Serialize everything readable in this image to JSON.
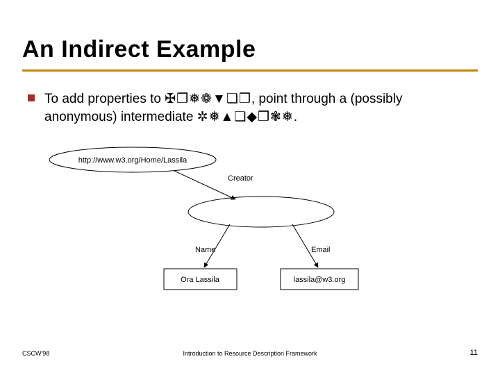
{
  "title": "An Indirect Example",
  "bullet": {
    "pre": "To add properties to ",
    "sym1": "✠❒❅❁▼❏❒",
    "mid": ", point through a (possibly anonymous) intermediate ",
    "sym2": "✲❅▲❏◆❒❃❅",
    "post": "."
  },
  "diagram": {
    "top_node": "http://www.w3.org/Home/Lassila",
    "edge_creator": "Creator",
    "edge_name": "Name",
    "edge_email": "Email",
    "box_name": "Ora Lassila",
    "box_email": "lassila@w3.org"
  },
  "footer": {
    "left": "CSCW'98",
    "center": "Introduction to Resource Description Framework",
    "page": "11"
  }
}
